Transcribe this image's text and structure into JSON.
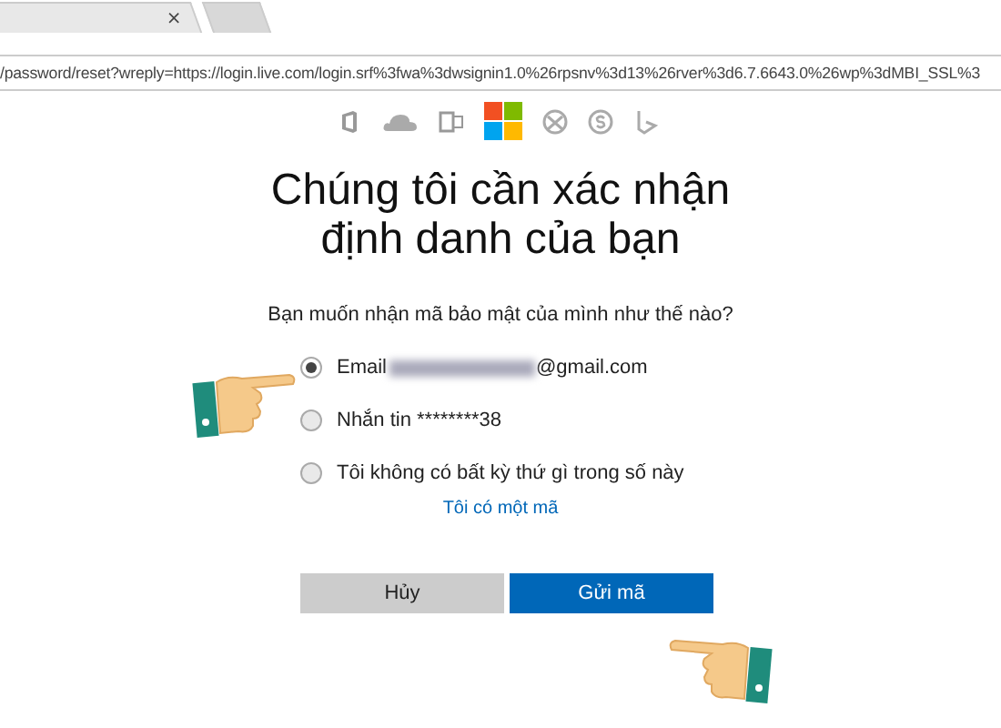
{
  "browser": {
    "tabs": [
      {
        "close": "×",
        "selected": true
      },
      {
        "selected": false
      }
    ],
    "address": "/password/reset?wreply=https://login.live.com/login.srf%3fwa%3dwsignin1.0%26rpsnv%3d13%26rver%3d6.7.6643.0%26wp%3dMBI_SSL%3"
  },
  "heading": "Chúng tôi cần xác nhận định danh của bạn",
  "question": "Bạn muốn nhận mã bảo mật của mình như thế nào?",
  "options": [
    {
      "kind": "email",
      "label": "Email",
      "suffix": "@gmail.com",
      "selected": true
    },
    {
      "kind": "text",
      "label": "Nhắn tin ********38",
      "selected": false
    },
    {
      "kind": "text",
      "label": "Tôi không có bất kỳ thứ gì trong số này",
      "selected": false
    }
  ],
  "link": "Tôi có một mã",
  "buttons": [
    {
      "label": "Hủy",
      "kind": "secondary"
    },
    {
      "label": "Gửi mã",
      "kind": "primary"
    }
  ]
}
